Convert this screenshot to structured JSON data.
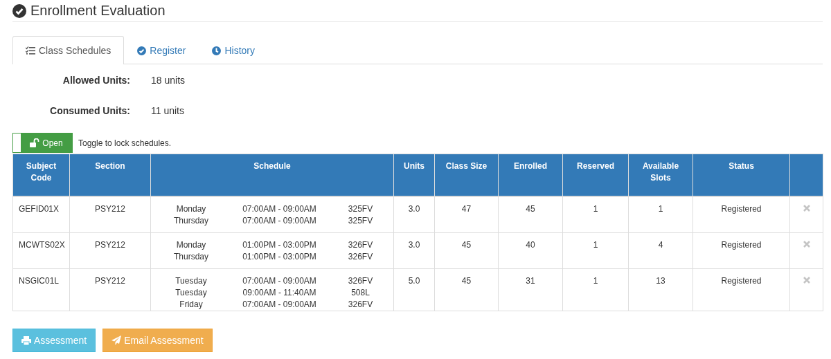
{
  "page": {
    "title": "Enrollment Evaluation"
  },
  "tabs": [
    {
      "label": "Class Schedules",
      "selected": true
    },
    {
      "label": "Register",
      "selected": false
    },
    {
      "label": "History",
      "selected": false
    }
  ],
  "summary": [
    {
      "label": "Allowed Units:",
      "value": "18 units"
    },
    {
      "label": "Consumed Units:",
      "value": "11 units"
    }
  ],
  "lock_toggle": {
    "label": "Open",
    "locked": false,
    "hint": "Toggle to lock schedules."
  },
  "table": {
    "columns": [
      "Subject Code",
      "Section",
      "Schedule",
      "Units",
      "Class Size",
      "Enrolled",
      "Reserved",
      "Available Slots",
      "Status"
    ],
    "rows": [
      {
        "subject_code": "GEFID01X",
        "section": "PSY212",
        "schedule": [
          {
            "day": "Monday",
            "time": "07:00AM - 09:00AM",
            "room": "325FV"
          },
          {
            "day": "Thursday",
            "time": "07:00AM - 09:00AM",
            "room": "325FV"
          }
        ],
        "units": "3.0",
        "class_size": "47",
        "enrolled": "45",
        "reserved": "1",
        "available_slots": "1",
        "status": "Registered"
      },
      {
        "subject_code": "MCWTS02X",
        "section": "PSY212",
        "schedule": [
          {
            "day": "Monday",
            "time": "01:00PM - 03:00PM",
            "room": "326FV"
          },
          {
            "day": "Thursday",
            "time": "01:00PM - 03:00PM",
            "room": "326FV"
          }
        ],
        "units": "3.0",
        "class_size": "45",
        "enrolled": "40",
        "reserved": "1",
        "available_slots": "4",
        "status": "Registered"
      },
      {
        "subject_code": "NSGIC01L",
        "section": "PSY212",
        "schedule": [
          {
            "day": "Tuesday",
            "time": "07:00AM - 09:00AM",
            "room": "326FV"
          },
          {
            "day": "Tuesday",
            "time": "09:00AM - 11:40AM",
            "room": "508L"
          },
          {
            "day": "Friday",
            "time": "07:00AM - 09:00AM",
            "room": "326FV"
          }
        ],
        "units": "5.0",
        "class_size": "45",
        "enrolled": "31",
        "reserved": "1",
        "available_slots": "13",
        "status": "Registered"
      }
    ]
  },
  "buttons": [
    {
      "label": "Assessment",
      "kind": "print"
    },
    {
      "label": "Email Assessment",
      "kind": "email"
    }
  ]
}
